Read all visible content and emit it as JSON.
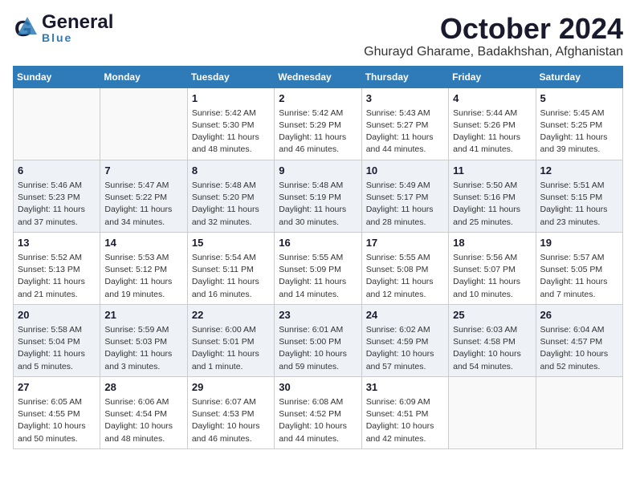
{
  "header": {
    "logo_general": "General",
    "logo_blue": "Blue",
    "month_title": "October 2024",
    "location": "Ghurayd Gharame, Badakhshan, Afghanistan"
  },
  "weekdays": [
    "Sunday",
    "Monday",
    "Tuesday",
    "Wednesday",
    "Thursday",
    "Friday",
    "Saturday"
  ],
  "weeks": [
    [
      {
        "day": "",
        "info": ""
      },
      {
        "day": "",
        "info": ""
      },
      {
        "day": "1",
        "info": "Sunrise: 5:42 AM\nSunset: 5:30 PM\nDaylight: 11 hours and 48 minutes."
      },
      {
        "day": "2",
        "info": "Sunrise: 5:42 AM\nSunset: 5:29 PM\nDaylight: 11 hours and 46 minutes."
      },
      {
        "day": "3",
        "info": "Sunrise: 5:43 AM\nSunset: 5:27 PM\nDaylight: 11 hours and 44 minutes."
      },
      {
        "day": "4",
        "info": "Sunrise: 5:44 AM\nSunset: 5:26 PM\nDaylight: 11 hours and 41 minutes."
      },
      {
        "day": "5",
        "info": "Sunrise: 5:45 AM\nSunset: 5:25 PM\nDaylight: 11 hours and 39 minutes."
      }
    ],
    [
      {
        "day": "6",
        "info": "Sunrise: 5:46 AM\nSunset: 5:23 PM\nDaylight: 11 hours and 37 minutes."
      },
      {
        "day": "7",
        "info": "Sunrise: 5:47 AM\nSunset: 5:22 PM\nDaylight: 11 hours and 34 minutes."
      },
      {
        "day": "8",
        "info": "Sunrise: 5:48 AM\nSunset: 5:20 PM\nDaylight: 11 hours and 32 minutes."
      },
      {
        "day": "9",
        "info": "Sunrise: 5:48 AM\nSunset: 5:19 PM\nDaylight: 11 hours and 30 minutes."
      },
      {
        "day": "10",
        "info": "Sunrise: 5:49 AM\nSunset: 5:17 PM\nDaylight: 11 hours and 28 minutes."
      },
      {
        "day": "11",
        "info": "Sunrise: 5:50 AM\nSunset: 5:16 PM\nDaylight: 11 hours and 25 minutes."
      },
      {
        "day": "12",
        "info": "Sunrise: 5:51 AM\nSunset: 5:15 PM\nDaylight: 11 hours and 23 minutes."
      }
    ],
    [
      {
        "day": "13",
        "info": "Sunrise: 5:52 AM\nSunset: 5:13 PM\nDaylight: 11 hours and 21 minutes."
      },
      {
        "day": "14",
        "info": "Sunrise: 5:53 AM\nSunset: 5:12 PM\nDaylight: 11 hours and 19 minutes."
      },
      {
        "day": "15",
        "info": "Sunrise: 5:54 AM\nSunset: 5:11 PM\nDaylight: 11 hours and 16 minutes."
      },
      {
        "day": "16",
        "info": "Sunrise: 5:55 AM\nSunset: 5:09 PM\nDaylight: 11 hours and 14 minutes."
      },
      {
        "day": "17",
        "info": "Sunrise: 5:55 AM\nSunset: 5:08 PM\nDaylight: 11 hours and 12 minutes."
      },
      {
        "day": "18",
        "info": "Sunrise: 5:56 AM\nSunset: 5:07 PM\nDaylight: 11 hours and 10 minutes."
      },
      {
        "day": "19",
        "info": "Sunrise: 5:57 AM\nSunset: 5:05 PM\nDaylight: 11 hours and 7 minutes."
      }
    ],
    [
      {
        "day": "20",
        "info": "Sunrise: 5:58 AM\nSunset: 5:04 PM\nDaylight: 11 hours and 5 minutes."
      },
      {
        "day": "21",
        "info": "Sunrise: 5:59 AM\nSunset: 5:03 PM\nDaylight: 11 hours and 3 minutes."
      },
      {
        "day": "22",
        "info": "Sunrise: 6:00 AM\nSunset: 5:01 PM\nDaylight: 11 hours and 1 minute."
      },
      {
        "day": "23",
        "info": "Sunrise: 6:01 AM\nSunset: 5:00 PM\nDaylight: 10 hours and 59 minutes."
      },
      {
        "day": "24",
        "info": "Sunrise: 6:02 AM\nSunset: 4:59 PM\nDaylight: 10 hours and 57 minutes."
      },
      {
        "day": "25",
        "info": "Sunrise: 6:03 AM\nSunset: 4:58 PM\nDaylight: 10 hours and 54 minutes."
      },
      {
        "day": "26",
        "info": "Sunrise: 6:04 AM\nSunset: 4:57 PM\nDaylight: 10 hours and 52 minutes."
      }
    ],
    [
      {
        "day": "27",
        "info": "Sunrise: 6:05 AM\nSunset: 4:55 PM\nDaylight: 10 hours and 50 minutes."
      },
      {
        "day": "28",
        "info": "Sunrise: 6:06 AM\nSunset: 4:54 PM\nDaylight: 10 hours and 48 minutes."
      },
      {
        "day": "29",
        "info": "Sunrise: 6:07 AM\nSunset: 4:53 PM\nDaylight: 10 hours and 46 minutes."
      },
      {
        "day": "30",
        "info": "Sunrise: 6:08 AM\nSunset: 4:52 PM\nDaylight: 10 hours and 44 minutes."
      },
      {
        "day": "31",
        "info": "Sunrise: 6:09 AM\nSunset: 4:51 PM\nDaylight: 10 hours and 42 minutes."
      },
      {
        "day": "",
        "info": ""
      },
      {
        "day": "",
        "info": ""
      }
    ]
  ]
}
